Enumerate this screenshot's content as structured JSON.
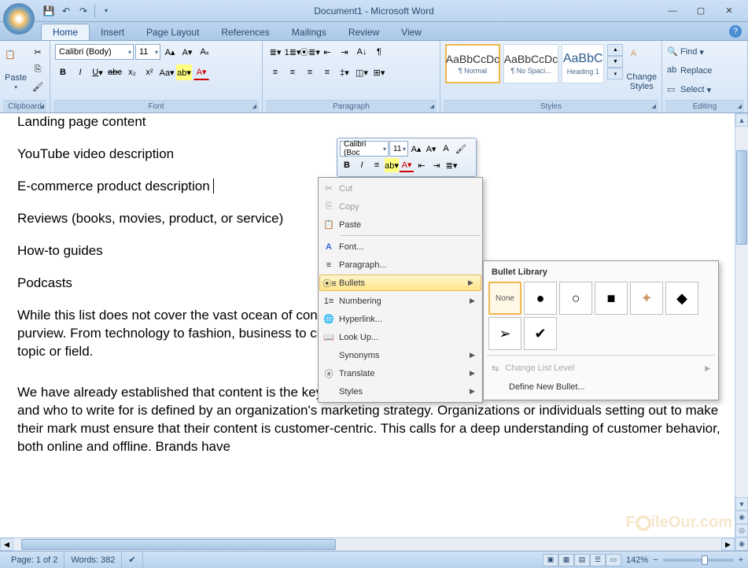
{
  "window": {
    "title": "Document1 - Microsoft Word"
  },
  "tabs": [
    "Home",
    "Insert",
    "Page Layout",
    "References",
    "Mailings",
    "Review",
    "View"
  ],
  "active_tab": "Home",
  "ribbon": {
    "clipboard": {
      "label": "Clipboard",
      "paste": "Paste"
    },
    "font": {
      "label": "Font",
      "name": "Calibri (Body)",
      "size": "11"
    },
    "paragraph": {
      "label": "Paragraph"
    },
    "styles": {
      "label": "Styles",
      "items": [
        {
          "sample": "AaBbCcDc",
          "name": "¶ Normal",
          "selected": true
        },
        {
          "sample": "AaBbCcDc",
          "name": "¶ No Spaci...",
          "selected": false
        },
        {
          "sample": "AaBbC",
          "name": "Heading 1",
          "selected": false
        }
      ],
      "change": "Change Styles"
    },
    "editing": {
      "label": "Editing",
      "find": "Find",
      "replace": "Replace",
      "select": "Select"
    }
  },
  "mini_toolbar": {
    "font": "Calibri (Boc",
    "size": "11"
  },
  "context_menu": [
    {
      "icon": "cut",
      "label": "Cut",
      "disabled": true
    },
    {
      "icon": "copy",
      "label": "Copy",
      "disabled": true
    },
    {
      "icon": "paste",
      "label": "Paste"
    },
    {
      "sep": true
    },
    {
      "icon": "A",
      "label": "Font..."
    },
    {
      "icon": "para",
      "label": "Paragraph..."
    },
    {
      "icon": "bullets",
      "label": "Bullets",
      "submenu": true,
      "hover": true
    },
    {
      "icon": "number",
      "label": "Numbering",
      "submenu": true
    },
    {
      "icon": "link",
      "label": "Hyperlink..."
    },
    {
      "icon": "lookup",
      "label": "Look Up..."
    },
    {
      "icon": "",
      "label": "Synonyms",
      "submenu": true
    },
    {
      "icon": "trans",
      "label": "Translate",
      "submenu": true
    },
    {
      "icon": "",
      "label": "Styles",
      "submenu": true
    }
  ],
  "bullet_library": {
    "header": "Bullet Library",
    "cells": [
      "None",
      "●",
      "○",
      "■",
      "❖",
      "◆",
      "➢",
      "✔"
    ],
    "change_level": "Change List Level",
    "define": "Define New Bullet..."
  },
  "document": {
    "lines": [
      "Landing page content",
      "YouTube video description",
      "E-commerce product description",
      "Reviews (books, movies, product, or service)",
      "How-to guides",
      "Podcasts"
    ],
    "para1": "While this list does not cover the vast ocean of content types that exist, it gives an idea about what comes within its purview. From technology to fashion, business to crafts, and mathematics to science, content can be created for any topic or field.",
    "para2": "We have already established that content is the key marketing tool for any organization in today's world. What, when, and who to write for is defined by an organization's marketing strategy. Organizations or individuals setting out to make their mark must ensure that their content is customer-centric. This calls for a deep understanding of customer behavior, both online and offline. Brands have"
  },
  "status": {
    "page": "Page: 1 of 2",
    "words": "Words: 382",
    "zoom": "142%"
  },
  "watermark": "ileOur.com"
}
